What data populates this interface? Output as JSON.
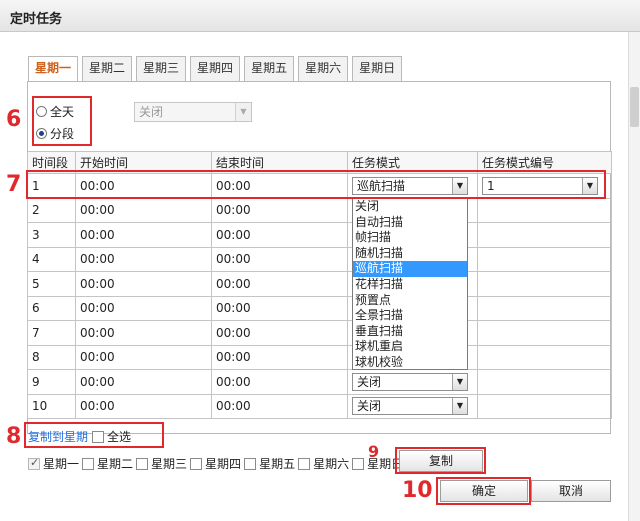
{
  "title": "定时任务",
  "tabs": [
    "星期一",
    "星期二",
    "星期三",
    "星期四",
    "星期五",
    "星期六",
    "星期日"
  ],
  "mode": {
    "all_day": "全天",
    "segmented": "分段",
    "selected": "分段",
    "all_day_select_value": "关闭"
  },
  "table": {
    "headers": [
      "时间段",
      "开始时间",
      "结束时间",
      "任务模式",
      "任务模式编号"
    ],
    "rows": [
      {
        "idx": "1",
        "start": "00:00",
        "end": "00:00",
        "mode": "巡航扫描",
        "mode_no": "1"
      },
      {
        "idx": "2",
        "start": "00:00",
        "end": "00:00",
        "mode": "",
        "mode_no": ""
      },
      {
        "idx": "3",
        "start": "00:00",
        "end": "00:00",
        "mode": "",
        "mode_no": ""
      },
      {
        "idx": "4",
        "start": "00:00",
        "end": "00:00",
        "mode": "",
        "mode_no": ""
      },
      {
        "idx": "5",
        "start": "00:00",
        "end": "00:00",
        "mode": "",
        "mode_no": ""
      },
      {
        "idx": "6",
        "start": "00:00",
        "end": "00:00",
        "mode": "",
        "mode_no": ""
      },
      {
        "idx": "7",
        "start": "00:00",
        "end": "00:00",
        "mode": "",
        "mode_no": ""
      },
      {
        "idx": "8",
        "start": "00:00",
        "end": "00:00",
        "mode": "",
        "mode_no": ""
      },
      {
        "idx": "9",
        "start": "00:00",
        "end": "00:00",
        "mode": "关闭",
        "mode_no": ""
      },
      {
        "idx": "10",
        "start": "00:00",
        "end": "00:00",
        "mode": "关闭",
        "mode_no": ""
      }
    ]
  },
  "dropdown_options": [
    "关闭",
    "自动扫描",
    "帧扫描",
    "随机扫描",
    "巡航扫描",
    "花样扫描",
    "预置点",
    "全景扫描",
    "垂直扫描",
    "球机重启",
    "球机校验"
  ],
  "dropdown_highlight": "巡航扫描",
  "copy": {
    "link": "复制到星期",
    "select_all": "全选"
  },
  "copy_days": [
    "星期一",
    "星期二",
    "星期三",
    "星期四",
    "星期五",
    "星期六",
    "星期日"
  ],
  "buttons": {
    "copy": "复制",
    "ok": "确定",
    "cancel": "取消"
  },
  "annotations": [
    "6",
    "7",
    "8",
    "9",
    "10"
  ],
  "colors": {
    "annotation": "#e0292c",
    "active_tab": "#d0601a",
    "highlight": "#3399ff",
    "link": "#2a6fd6"
  }
}
